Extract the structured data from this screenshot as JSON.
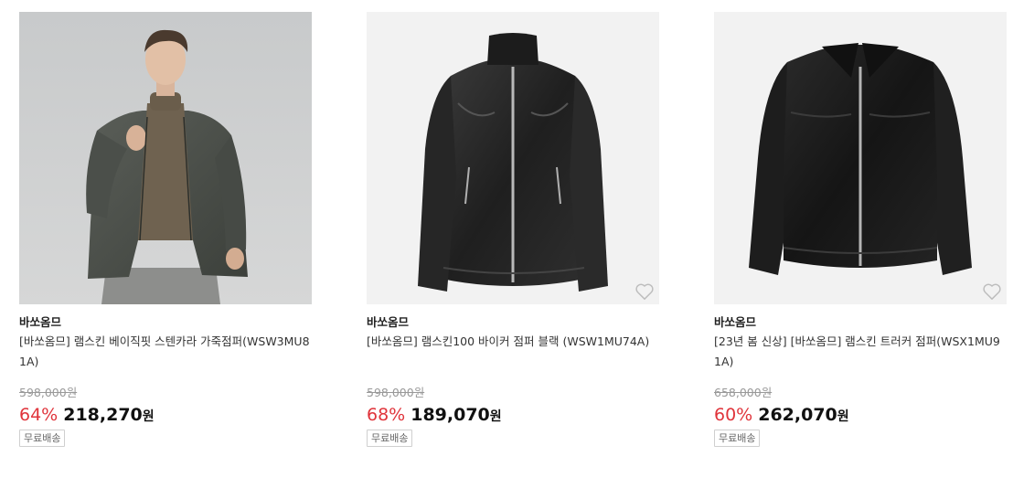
{
  "products": [
    {
      "brand": "바쏘옴므",
      "title": "[바쏘옴므] 램스킨 베이직핏 스텐카라 가죽점퍼(WSW3MU81A)",
      "original_price": "598,000원",
      "discount_rate": "64%",
      "sale_price": "218,270",
      "currency": "원",
      "shipping_badge": "무료배송",
      "image_icon": "model-wearing-jacket-photo",
      "has_wishlist": false
    },
    {
      "brand": "바쏘옴므",
      "title": "[바쏘옴므] 램스킨100 바이커 점퍼 블랙 (WSW1MU74A)",
      "original_price": "598,000원",
      "discount_rate": "68%",
      "sale_price": "189,070",
      "currency": "원",
      "shipping_badge": "무료배송",
      "image_icon": "leather-biker-jacket-photo",
      "has_wishlist": true
    },
    {
      "brand": "바쏘옴므",
      "title": "[23년 봄 신상] [바쏘옴므] 램스킨 트러커 점퍼(WSX1MU91A)",
      "original_price": "658,000원",
      "discount_rate": "60%",
      "sale_price": "262,070",
      "currency": "원",
      "shipping_badge": "무료배송",
      "image_icon": "leather-trucker-jacket-photo",
      "has_wishlist": true
    }
  ],
  "colors": {
    "discount": "#e0343b",
    "image_background": "#f2f2f2",
    "model_background": "#c9cbcb"
  }
}
